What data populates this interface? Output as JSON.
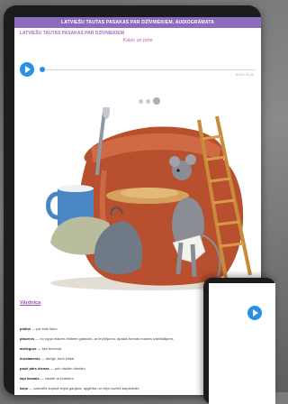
{
  "header": {
    "app_title": "LATVIEŠU TAUTAS PASAKAS PAR DZĪVNIEKIEM. AUDIOGRĀMATA",
    "book_title": "LATVIEŠU TAUTAS PASAKAS PAR DZĪVNIEKIEM",
    "story_title": "Kaķis un pele"
  },
  "player": {
    "time": "00:00 / 04:36",
    "progress": 0
  },
  "carousel": {
    "count": 3,
    "active_index": 2
  },
  "vocabulary": {
    "title": "Vārdnīca",
    "items": [
      {
        "term": "pödiņi",
        "definition": "— pie kūts šķiru"
      },
      {
        "term": "placenis",
        "definition": "— no rupja maizes miltiem gatavots, ar ievārījumu, apaļas formas maizes izstrādājums"
      },
      {
        "term": "aizlieguŗs",
        "definition": "— šķir iemeņot"
      },
      {
        "term": "krustabenis",
        "definition": "— derīgs, kurš krīšdi"
      },
      {
        "term": "pauē pārs dienas",
        "definition": "— pēc dažām dienām"
      },
      {
        "term": "lapi kamais",
        "definition": "— vismēr ar kraŗšeni"
      },
      {
        "term": "kaņs",
        "definition": "— sakrotīts kopiņā teipis gaujiais, apģērba un vēja nozīmi aizpiedotie"
      }
    ]
  },
  "colors": {
    "accent": "#8d6bbf",
    "title_pink": "#c85fa6",
    "play_blue": "#2a8fe6"
  }
}
